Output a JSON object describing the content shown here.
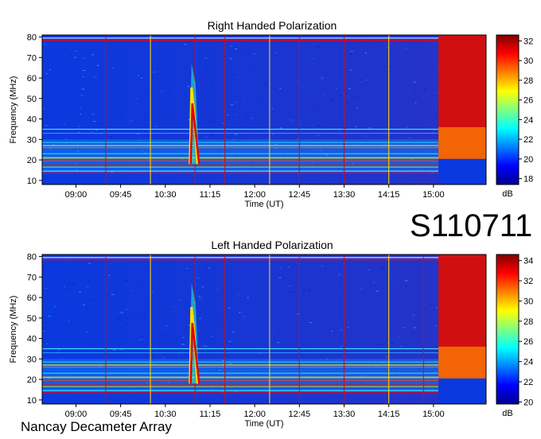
{
  "chart_data": [
    {
      "type": "heatmap",
      "title": "Right Handed Polarization",
      "xlabel": "Time (UT)",
      "ylabel": "Frequency (MHz)",
      "x_ticks": [
        "09:00",
        "09:45",
        "10:30",
        "11:15",
        "12:00",
        "12:45",
        "13:30",
        "14:15",
        "15:00"
      ],
      "y_ticks": [
        10,
        20,
        30,
        40,
        50,
        60,
        70,
        80
      ],
      "ylim": [
        8,
        81
      ],
      "colorbar": {
        "label": "dB",
        "range": [
          17.4,
          32.6
        ],
        "ticks": [
          18,
          20,
          22,
          24,
          26,
          28,
          30,
          32
        ]
      },
      "features": {
        "vertical_lines_ut": [
          "09:30",
          "10:15",
          "11:00",
          "11:30",
          "12:15",
          "12:45",
          "13:30",
          "14:15"
        ],
        "burst": {
          "start_ut": "10:54",
          "end_ut": "11:04",
          "freq_top_mhz": 67,
          "freq_bottom_mhz": 18
        },
        "calibration_block_start_ut": "15:05"
      }
    },
    {
      "type": "heatmap",
      "title": "Left Handed Polarization",
      "xlabel": "Time (UT)",
      "ylabel": "Frequency (MHz)",
      "x_ticks": [
        "09:00",
        "09:45",
        "10:30",
        "11:15",
        "12:00",
        "12:45",
        "13:30",
        "14:15",
        "15:00"
      ],
      "y_ticks": [
        10,
        20,
        30,
        40,
        50,
        60,
        70,
        80
      ],
      "ylim": [
        8,
        81
      ],
      "colorbar": {
        "label": "dB",
        "range": [
          19.8,
          34.6
        ],
        "ticks": [
          20,
          22,
          24,
          26,
          28,
          30,
          32,
          34
        ]
      },
      "features": {
        "vertical_lines_ut": [
          "09:30",
          "10:15",
          "11:00",
          "11:30",
          "12:15",
          "12:45",
          "13:30",
          "14:15",
          "14:50"
        ],
        "burst": {
          "start_ut": "10:54",
          "end_ut": "11:04",
          "freq_top_mhz": 67,
          "freq_bottom_mhz": 18
        },
        "calibration_block_start_ut": "15:05"
      }
    }
  ],
  "label": "S110711",
  "footer": "Nancay Decameter Array"
}
